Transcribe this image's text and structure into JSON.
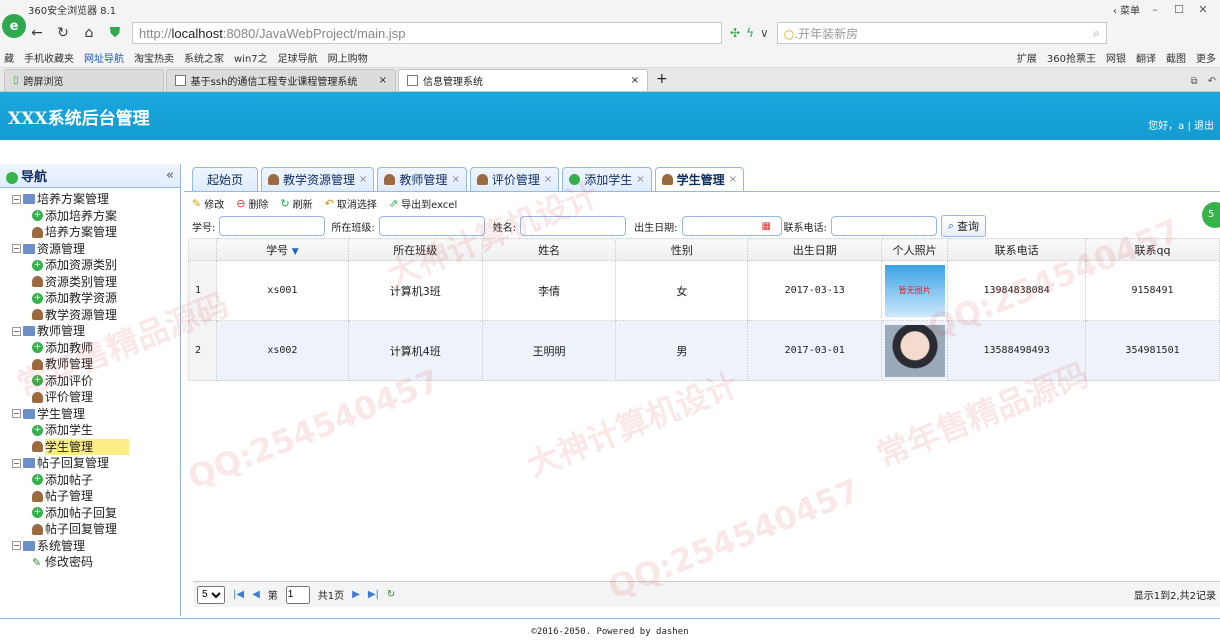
{
  "browser": {
    "window_title": "360安全浏览器 8.1",
    "window_menu": "菜单",
    "url_prefix": "http://",
    "url_host": "localhost",
    "url_rest": ":8080/JavaWebProject/main.jsp",
    "search_placeholder": "开年装新房",
    "bookmarks": [
      "藏",
      "手机收藏夹",
      "网址导航",
      "淘宝热卖",
      "系统之家",
      "win7之",
      "足球导航",
      "网上购物"
    ],
    "bookmarks_right": [
      "扩展",
      "360抢票王",
      "网银",
      "翻译",
      "截图",
      "更多"
    ],
    "tabs": [
      {
        "label": "跨屏浏览",
        "active": false
      },
      {
        "label": "基于ssh的通信工程专业课程管理系统",
        "active": false
      },
      {
        "label": "信息管理系统",
        "active": true
      }
    ]
  },
  "app": {
    "title": "XXX系统后台管理",
    "user_text": "您好，a  |  退出"
  },
  "nav": {
    "title": "导航",
    "collapse_icon": "«",
    "groups": [
      {
        "label": "培养方案管理",
        "children": [
          {
            "label": "添加培养方案",
            "icon": "add"
          },
          {
            "label": "培养方案管理",
            "icon": "manage"
          }
        ]
      },
      {
        "label": "资源管理",
        "children": [
          {
            "label": "添加资源类别",
            "icon": "add"
          },
          {
            "label": "资源类别管理",
            "icon": "manage"
          },
          {
            "label": "添加教学资源",
            "icon": "add"
          },
          {
            "label": "教学资源管理",
            "icon": "manage"
          }
        ]
      },
      {
        "label": "教师管理",
        "children": [
          {
            "label": "添加教师",
            "icon": "add"
          },
          {
            "label": "教师管理",
            "icon": "manage"
          },
          {
            "label": "添加评价",
            "icon": "add"
          },
          {
            "label": "评价管理",
            "icon": "manage"
          }
        ]
      },
      {
        "label": "学生管理",
        "children": [
          {
            "label": "添加学生",
            "icon": "add"
          },
          {
            "label": "学生管理",
            "icon": "manage",
            "selected": true
          }
        ]
      },
      {
        "label": "帖子回复管理",
        "children": [
          {
            "label": "添加帖子",
            "icon": "add"
          },
          {
            "label": "帖子管理",
            "icon": "manage"
          },
          {
            "label": "添加帖子回复",
            "icon": "add"
          },
          {
            "label": "帖子回复管理",
            "icon": "manage"
          }
        ]
      },
      {
        "label": "系统管理",
        "children": [
          {
            "label": "修改密码",
            "icon": "edit"
          }
        ]
      }
    ]
  },
  "page_tabs": [
    {
      "label": "起始页",
      "closable": false,
      "icon": "",
      "active": false
    },
    {
      "label": "教学资源管理",
      "closable": true,
      "icon": "manage",
      "active": false
    },
    {
      "label": "教师管理",
      "closable": true,
      "icon": "manage",
      "active": false
    },
    {
      "label": "评价管理",
      "closable": true,
      "icon": "manage",
      "active": false
    },
    {
      "label": "添加学生",
      "closable": true,
      "icon": "add",
      "active": false
    },
    {
      "label": "学生管理",
      "closable": true,
      "icon": "manage",
      "active": true
    }
  ],
  "toolbar": {
    "edit": "修改",
    "delete": "删除",
    "refresh": "刷新",
    "cancel_select": "取消选择",
    "export": "导出到excel"
  },
  "search": {
    "student_no_label": "学号:",
    "class_label": "所在班级:",
    "name_label": "姓名:",
    "birth_label": "出生日期:",
    "phone_label": "联系电话:",
    "query_button": "查询",
    "student_no_value": "",
    "class_value": "",
    "name_value": "",
    "birth_value": "",
    "phone_value": ""
  },
  "grid": {
    "columns": [
      "学号",
      "所在班级",
      "姓名",
      "性别",
      "出生日期",
      "个人照片",
      "联系电话",
      "联系qq"
    ],
    "rows": [
      {
        "num": "1",
        "student_no": "xs001",
        "class": "计算机3班",
        "name": "李倩",
        "gender": "女",
        "birth": "2017-03-13",
        "photo": "暂无图片",
        "phone": "13984838084",
        "qq": "9158491"
      },
      {
        "num": "2",
        "student_no": "xs002",
        "class": "计算机4班",
        "name": "王明明",
        "gender": "男",
        "birth": "2017-03-01",
        "photo": "",
        "phone": "13588498493",
        "qq": "354981501"
      }
    ]
  },
  "pager": {
    "page_size": "5",
    "page_prefix": "第",
    "page_value": "1",
    "page_suffix": "共1页",
    "info": "显示1到2,共2记录"
  },
  "footer": "©2016-2050. Powered by dashen",
  "watermarks": [
    "常年售精品源码",
    "大神计算机设计",
    "QQ:254540457"
  ]
}
